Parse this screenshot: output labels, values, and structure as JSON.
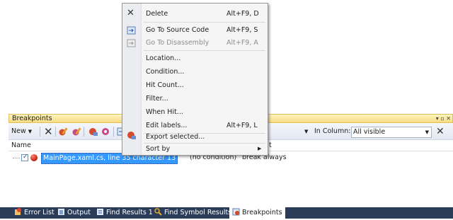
{
  "context_menu": {
    "items": [
      {
        "label": "Delete",
        "shortcut": "Alt+F9, D",
        "icon": "delete-x-icon",
        "enabled": true
      },
      {
        "label": "Go To Source Code",
        "shortcut": "Alt+F9, S",
        "icon": "go-to-source-icon",
        "enabled": true
      },
      {
        "label": "Go To Disassembly",
        "shortcut": "Alt+F9, A",
        "icon": "go-to-disassembly-icon",
        "enabled": false
      },
      {
        "label": "Location...",
        "shortcut": "",
        "enabled": true
      },
      {
        "label": "Condition...",
        "shortcut": "",
        "enabled": true
      },
      {
        "label": "Hit Count...",
        "shortcut": "",
        "enabled": true
      },
      {
        "label": "Filter...",
        "shortcut": "",
        "enabled": true
      },
      {
        "label": "When Hit...",
        "shortcut": "",
        "enabled": true
      },
      {
        "label": "Edit labels...",
        "shortcut": "Alt+F9, L",
        "enabled": true
      },
      {
        "label": "Export selected...",
        "shortcut": "",
        "icon": "export-breakpoints-icon",
        "enabled": true
      },
      {
        "label": "Sort by",
        "shortcut": "",
        "submenu": true,
        "enabled": true
      }
    ]
  },
  "breakpoints_window": {
    "title": "Breakpoints",
    "toolbar": {
      "new_label": "New",
      "in_column_label": "In Column:",
      "in_column_value": "All visible"
    },
    "columns": {
      "name": "Name",
      "hit_count_partial": "t"
    },
    "rows": [
      {
        "name": "MainPage.xaml.cs, line 35 character 13",
        "condition": "(no condition)",
        "hit_count": "break always",
        "enabled": true
      }
    ]
  },
  "tabs": [
    {
      "label": "Error List",
      "icon": "error-list-icon",
      "active": false
    },
    {
      "label": "Output",
      "icon": "output-icon",
      "active": false
    },
    {
      "label": "Find Results 1",
      "icon": "find-results-icon",
      "active": false
    },
    {
      "label": "Find Symbol Results",
      "icon": "find-symbol-icon",
      "active": false
    },
    {
      "label": "Breakpoints",
      "icon": "breakpoints-icon",
      "active": true
    }
  ],
  "colors": {
    "selection": "#3399ff",
    "tab_strip": "#2b3c59",
    "title_bar": "#f7dc84"
  }
}
